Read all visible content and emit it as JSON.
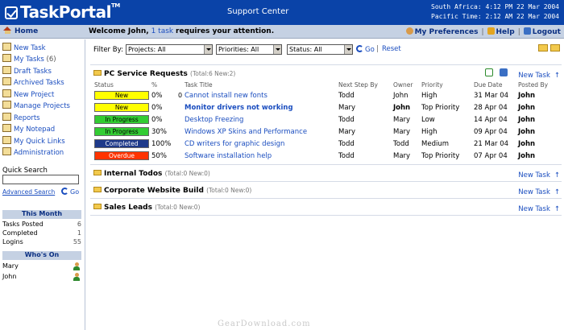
{
  "header": {
    "logo": "TaskPortal",
    "logo_tm": "TM",
    "center_title": "Support Center",
    "clock_line1": "South Africa: 4:12 PM 22 Mar 2004",
    "clock_line2": "Pacific Time: 2:12 AM 22 Mar 2004"
  },
  "topbar": {
    "home": "Home",
    "welcome_prefix": "Welcome John,",
    "welcome_link": "1 task",
    "welcome_suffix": "requires your attention.",
    "preferences": "My Preferences",
    "help": "Help",
    "logout": "Logout"
  },
  "sidebar": {
    "items": [
      {
        "label": "New Task"
      },
      {
        "label": "My Tasks",
        "count": "(6)"
      },
      {
        "label": "Draft Tasks"
      },
      {
        "label": "Archived Tasks"
      },
      {
        "label": "New Project"
      },
      {
        "label": "Manage Projects"
      },
      {
        "label": "Reports"
      },
      {
        "label": "My Notepad"
      },
      {
        "label": "My Quick Links"
      },
      {
        "label": "Administration"
      }
    ],
    "quick_search_label": "Quick Search",
    "quick_search_value": "",
    "advanced_search": "Advanced Search",
    "go": "Go",
    "this_month": {
      "title": "This Month",
      "rows": [
        {
          "label": "Tasks Posted",
          "value": "6"
        },
        {
          "label": "Completed",
          "value": "1"
        },
        {
          "label": "Logins",
          "value": "55"
        }
      ]
    },
    "whos_on": {
      "title": "Who's On",
      "users": [
        "Mary",
        "John"
      ]
    }
  },
  "filter": {
    "label": "Filter By:",
    "projects": "Projects: All",
    "priorities": "Priorities: All",
    "status": "Status: All",
    "go": "Go",
    "reset": "Reset"
  },
  "groups": [
    {
      "title": "PC Service Requests",
      "meta": "(Total:6 New:2)",
      "new_task": "New Task"
    },
    {
      "title": "Internal Todos",
      "meta": "(Total:0 New:0)",
      "new_task": "New Task"
    },
    {
      "title": "Corporate Website Build",
      "meta": "(Total:0 New:0)",
      "new_task": "New Task"
    },
    {
      "title": "Sales Leads",
      "meta": "(Total:0 New:0)",
      "new_task": "New Task"
    }
  ],
  "columns": [
    "Status",
    "%",
    "Task Title",
    "Next Step By",
    "Owner",
    "Priority",
    "Due Date",
    "Posted By"
  ],
  "tasks": [
    {
      "status": "New",
      "color": "#ffff00",
      "fg": "#000000",
      "pct": "0%",
      "clip": "0",
      "title": "Cannot install new fonts",
      "bold_title": false,
      "next": "Todd",
      "owner": "John",
      "owner_bold": false,
      "priority": "High",
      "due": "31 Mar 04",
      "posted": "John"
    },
    {
      "status": "New",
      "color": "#ffff00",
      "fg": "#000000",
      "pct": "0%",
      "clip": "",
      "title": "Monitor drivers not working",
      "bold_title": true,
      "next": "Mary",
      "owner": "John",
      "owner_bold": true,
      "priority": "Top Priority",
      "due": "28 Apr 04",
      "posted": "John"
    },
    {
      "status": "In Progress",
      "color": "#33cc33",
      "fg": "#000000",
      "pct": "0%",
      "clip": "",
      "title": "Desktop Freezing",
      "bold_title": false,
      "next": "Todd",
      "owner": "Mary",
      "owner_bold": false,
      "priority": "Low",
      "due": "14 Apr 04",
      "posted": "John"
    },
    {
      "status": "In Progress",
      "color": "#33cc33",
      "fg": "#000000",
      "pct": "30%",
      "clip": "",
      "title": "Windows XP Skins and Performance",
      "bold_title": false,
      "next": "Mary",
      "owner": "Mary",
      "owner_bold": false,
      "priority": "High",
      "due": "09 Apr 04",
      "posted": "John"
    },
    {
      "status": "Completed",
      "color": "#1f3a8a",
      "fg": "#ffffff",
      "pct": "100%",
      "clip": "",
      "title": "CD writers for graphic design",
      "bold_title": false,
      "next": "Todd",
      "owner": "Todd",
      "owner_bold": false,
      "priority": "Medium",
      "due": "21 Mar 04",
      "posted": "John"
    },
    {
      "status": "Overdue",
      "color": "#ff3300",
      "fg": "#ffffff",
      "pct": "50%",
      "clip": "",
      "title": "Software installation help",
      "bold_title": false,
      "next": "Todd",
      "owner": "Mary",
      "owner_bold": false,
      "priority": "Top Priority",
      "due": "07 Apr 04",
      "posted": "John"
    }
  ],
  "watermark": "GearDownload.com"
}
